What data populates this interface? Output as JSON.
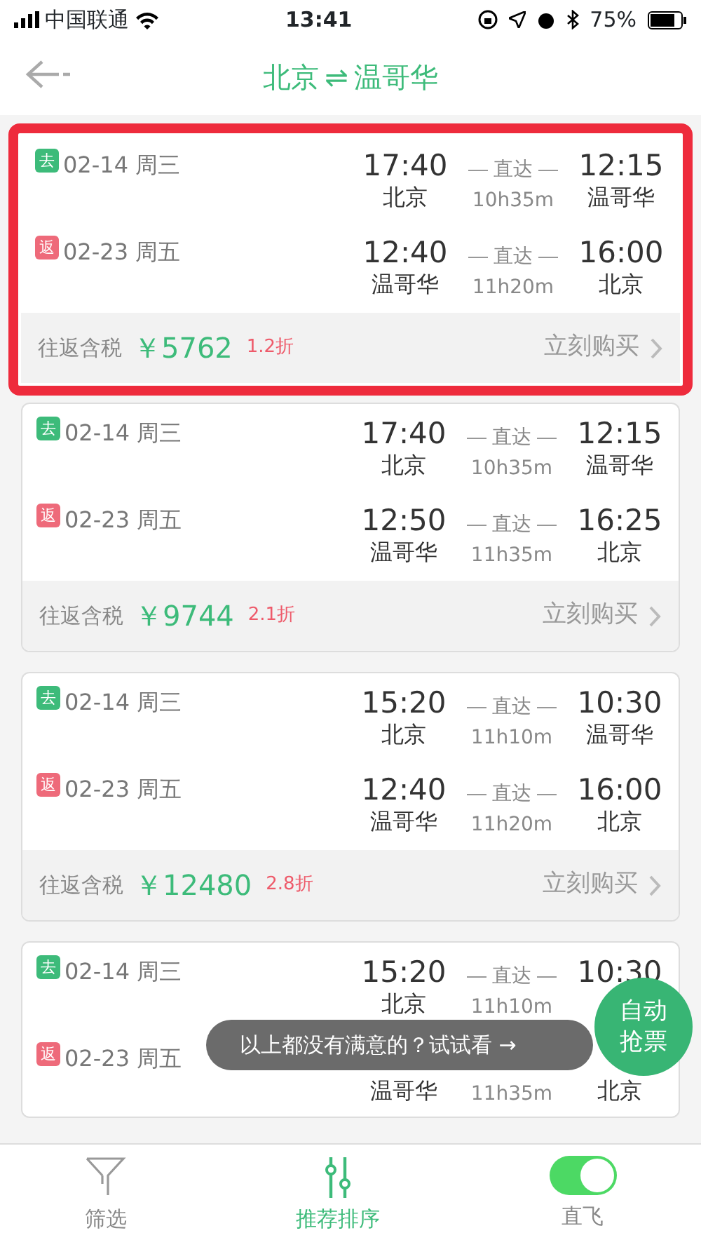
{
  "status_bar": {
    "carrier": "中国联通",
    "time": "13:41",
    "battery": "75%"
  },
  "header": {
    "from": "北京",
    "swap": "⇌",
    "to": "温哥华"
  },
  "trips": [
    {
      "highlighted": true,
      "legs": [
        {
          "kind": "out",
          "tag": "去",
          "date": "02-14 周三",
          "dep_time": "17:40",
          "dep_city": "北京",
          "direct": "直达",
          "duration": "10h35m",
          "arr_time": "12:15",
          "arr_city": "温哥华"
        },
        {
          "kind": "return",
          "tag": "返",
          "date": "02-23 周五",
          "dep_time": "12:40",
          "dep_city": "温哥华",
          "direct": "直达",
          "duration": "11h20m",
          "arr_time": "16:00",
          "arr_city": "北京"
        }
      ],
      "price_label": "往返含税",
      "price": "￥5762",
      "discount": "1.2折",
      "buy": "立刻购买"
    },
    {
      "highlighted": false,
      "legs": [
        {
          "kind": "out",
          "tag": "去",
          "date": "02-14 周三",
          "dep_time": "17:40",
          "dep_city": "北京",
          "direct": "直达",
          "duration": "10h35m",
          "arr_time": "12:15",
          "arr_city": "温哥华"
        },
        {
          "kind": "return",
          "tag": "返",
          "date": "02-23 周五",
          "dep_time": "12:50",
          "dep_city": "温哥华",
          "direct": "直达",
          "duration": "11h35m",
          "arr_time": "16:25",
          "arr_city": "北京"
        }
      ],
      "price_label": "往返含税",
      "price": "￥9744",
      "discount": "2.1折",
      "buy": "立刻购买"
    },
    {
      "highlighted": false,
      "legs": [
        {
          "kind": "out",
          "tag": "去",
          "date": "02-14 周三",
          "dep_time": "15:20",
          "dep_city": "北京",
          "direct": "直达",
          "duration": "11h10m",
          "arr_time": "10:30",
          "arr_city": "温哥华"
        },
        {
          "kind": "return",
          "tag": "返",
          "date": "02-23 周五",
          "dep_time": "12:40",
          "dep_city": "温哥华",
          "direct": "直达",
          "duration": "11h20m",
          "arr_time": "16:00",
          "arr_city": "北京"
        }
      ],
      "price_label": "往返含税",
      "price": "￥12480",
      "discount": "2.8折",
      "buy": "立刻购买"
    },
    {
      "highlighted": false,
      "legs": [
        {
          "kind": "out",
          "tag": "去",
          "date": "02-14 周三",
          "dep_time": "15:20",
          "dep_city": "北京",
          "direct": "直达",
          "duration": "11h10m",
          "arr_time": "10:30"
        },
        {
          "kind": "return",
          "tag": "返",
          "date": "02-23 周五",
          "dep_city": "温哥华",
          "duration": "11h35m",
          "arr_city": "北京"
        }
      ]
    }
  ],
  "toast": {
    "text": "以上都没有满意的？试试看 →"
  },
  "fab": {
    "text": "自动抢票"
  },
  "bottom_bar": [
    {
      "kind": "filter",
      "label": "筛选",
      "selected": false
    },
    {
      "kind": "sort",
      "label": "推荐排序",
      "selected": true
    },
    {
      "kind": "toggle",
      "label": "直飞",
      "on": true
    }
  ]
}
